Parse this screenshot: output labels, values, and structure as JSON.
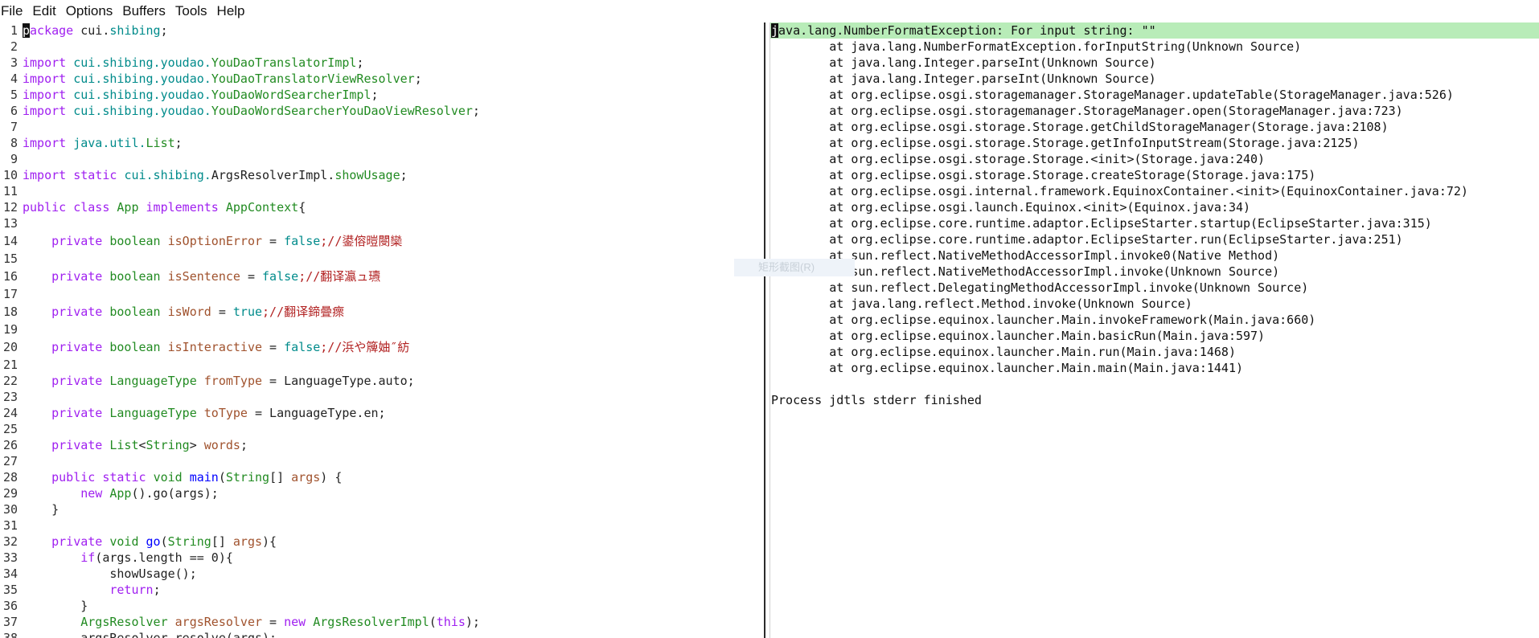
{
  "menu": [
    "File",
    "Edit",
    "Options",
    "Buffers",
    "Tools",
    "Help"
  ],
  "editor": {
    "lines": [
      {
        "n": "1",
        "parts": [
          {
            "t": "p",
            "c": "cursor"
          },
          {
            "t": "ackage ",
            "c": "kw"
          },
          {
            "t": "cui.",
            "c": ""
          },
          {
            "t": "shibing",
            "c": "pk"
          },
          {
            "t": ";",
            "c": ""
          }
        ]
      },
      {
        "n": "2",
        "parts": []
      },
      {
        "n": "3",
        "parts": [
          {
            "t": "import ",
            "c": "kw"
          },
          {
            "t": "cui.",
            "c": "pk"
          },
          {
            "t": "shibing.youdao.",
            "c": "pk"
          },
          {
            "t": "YouDaoTranslatorImpl",
            "c": "ty"
          },
          {
            "t": ";",
            "c": ""
          }
        ]
      },
      {
        "n": "4",
        "parts": [
          {
            "t": "import ",
            "c": "kw"
          },
          {
            "t": "cui.",
            "c": "pk"
          },
          {
            "t": "shibing.youdao.",
            "c": "pk"
          },
          {
            "t": "YouDaoTranslatorViewResolver",
            "c": "ty"
          },
          {
            "t": ";",
            "c": ""
          }
        ]
      },
      {
        "n": "5",
        "parts": [
          {
            "t": "import ",
            "c": "kw"
          },
          {
            "t": "cui.",
            "c": "pk"
          },
          {
            "t": "shibing.youdao.",
            "c": "pk"
          },
          {
            "t": "YouDaoWordSearcherImpl",
            "c": "ty"
          },
          {
            "t": ";",
            "c": ""
          }
        ]
      },
      {
        "n": "6",
        "parts": [
          {
            "t": "import ",
            "c": "kw"
          },
          {
            "t": "cui.",
            "c": "pk"
          },
          {
            "t": "shibing.youdao.",
            "c": "pk"
          },
          {
            "t": "YouDaoWordSearcherYouDaoViewResolver",
            "c": "ty"
          },
          {
            "t": ";",
            "c": ""
          }
        ]
      },
      {
        "n": "7",
        "parts": []
      },
      {
        "n": "8",
        "parts": [
          {
            "t": "import ",
            "c": "kw"
          },
          {
            "t": "java.util.",
            "c": "pk"
          },
          {
            "t": "List",
            "c": "ty"
          },
          {
            "t": ";",
            "c": ""
          }
        ]
      },
      {
        "n": "9",
        "parts": []
      },
      {
        "n": "10",
        "parts": [
          {
            "t": "import static ",
            "c": "kw"
          },
          {
            "t": "cui.shibing.",
            "c": "pk"
          },
          {
            "t": "ArgsResolverImpl.",
            "c": ""
          },
          {
            "t": "showUsage",
            "c": "ty"
          },
          {
            "t": ";",
            "c": ""
          }
        ]
      },
      {
        "n": "11",
        "parts": []
      },
      {
        "n": "12",
        "parts": [
          {
            "t": "public class ",
            "c": "kw"
          },
          {
            "t": "App ",
            "c": "ty"
          },
          {
            "t": "implements ",
            "c": "kw"
          },
          {
            "t": "AppContext",
            "c": "ty"
          },
          {
            "t": "{",
            "c": ""
          }
        ]
      },
      {
        "n": "13",
        "parts": []
      },
      {
        "n": "14",
        "tall": true,
        "parts": [
          {
            "t": "    private ",
            "c": "kw"
          },
          {
            "t": "boolean ",
            "c": "ty"
          },
          {
            "t": "isOptionError",
            "c": "var"
          },
          {
            "t": " = ",
            "c": ""
          },
          {
            "t": "false",
            "c": "cst"
          },
          {
            "t": ";//鍙傛暟閿欒",
            "c": "cm"
          }
        ]
      },
      {
        "n": "15",
        "parts": []
      },
      {
        "n": "16",
        "tall": true,
        "parts": [
          {
            "t": "    private ",
            "c": "kw"
          },
          {
            "t": "boolean ",
            "c": "ty"
          },
          {
            "t": "isSentence",
            "c": "var"
          },
          {
            "t": " = ",
            "c": ""
          },
          {
            "t": "false",
            "c": "cst"
          },
          {
            "t": ";//翻译瀛ュ瓙",
            "c": "cm"
          }
        ]
      },
      {
        "n": "17",
        "parts": []
      },
      {
        "n": "18",
        "tall": true,
        "parts": [
          {
            "t": "    private ",
            "c": "kw"
          },
          {
            "t": "boolean ",
            "c": "ty"
          },
          {
            "t": "isWord",
            "c": "var"
          },
          {
            "t": " = ",
            "c": ""
          },
          {
            "t": "true",
            "c": "cst"
          },
          {
            "t": ";//翻译鍗曡瘝",
            "c": "cm"
          }
        ]
      },
      {
        "n": "19",
        "parts": []
      },
      {
        "n": "20",
        "tall": true,
        "parts": [
          {
            "t": "    private ",
            "c": "kw"
          },
          {
            "t": "boolean ",
            "c": "ty"
          },
          {
            "t": "isInteractive",
            "c": "var"
          },
          {
            "t": " = ",
            "c": ""
          },
          {
            "t": "false",
            "c": "cst"
          },
          {
            "t": ";//浜や簰妯″紡",
            "c": "cm"
          }
        ]
      },
      {
        "n": "21",
        "parts": []
      },
      {
        "n": "22",
        "parts": [
          {
            "t": "    private ",
            "c": "kw"
          },
          {
            "t": "LanguageType ",
            "c": "ty"
          },
          {
            "t": "fromType",
            "c": "var"
          },
          {
            "t": " = LanguageType.auto;",
            "c": ""
          }
        ]
      },
      {
        "n": "23",
        "parts": []
      },
      {
        "n": "24",
        "parts": [
          {
            "t": "    private ",
            "c": "kw"
          },
          {
            "t": "LanguageType ",
            "c": "ty"
          },
          {
            "t": "toType",
            "c": "var"
          },
          {
            "t": " = LanguageType.en;",
            "c": ""
          }
        ]
      },
      {
        "n": "25",
        "parts": []
      },
      {
        "n": "26",
        "parts": [
          {
            "t": "    private ",
            "c": "kw"
          },
          {
            "t": "List",
            "c": "ty"
          },
          {
            "t": "<",
            "c": ""
          },
          {
            "t": "String",
            "c": "ty"
          },
          {
            "t": "> ",
            "c": ""
          },
          {
            "t": "words",
            "c": "var"
          },
          {
            "t": ";",
            "c": ""
          }
        ]
      },
      {
        "n": "27",
        "parts": []
      },
      {
        "n": "28",
        "parts": [
          {
            "t": "    public static ",
            "c": "kw"
          },
          {
            "t": "void ",
            "c": "ty"
          },
          {
            "t": "main",
            "c": "fn"
          },
          {
            "t": "(",
            "c": ""
          },
          {
            "t": "String",
            "c": "ty"
          },
          {
            "t": "[] ",
            "c": ""
          },
          {
            "t": "args",
            "c": "var"
          },
          {
            "t": ") {",
            "c": ""
          }
        ]
      },
      {
        "n": "29",
        "parts": [
          {
            "t": "        new ",
            "c": "kw"
          },
          {
            "t": "App",
            "c": "ty"
          },
          {
            "t": "().go(args);",
            "c": ""
          }
        ]
      },
      {
        "n": "30",
        "parts": [
          {
            "t": "    }",
            "c": ""
          }
        ]
      },
      {
        "n": "31",
        "parts": []
      },
      {
        "n": "32",
        "parts": [
          {
            "t": "    private ",
            "c": "kw"
          },
          {
            "t": "void ",
            "c": "ty"
          },
          {
            "t": "go",
            "c": "fn"
          },
          {
            "t": "(",
            "c": ""
          },
          {
            "t": "String",
            "c": "ty"
          },
          {
            "t": "[] ",
            "c": ""
          },
          {
            "t": "args",
            "c": "var"
          },
          {
            "t": "){",
            "c": ""
          }
        ]
      },
      {
        "n": "33",
        "parts": [
          {
            "t": "        if",
            "c": "kw"
          },
          {
            "t": "(args.length == 0){",
            "c": ""
          }
        ]
      },
      {
        "n": "34",
        "parts": [
          {
            "t": "            showUsage();",
            "c": ""
          }
        ]
      },
      {
        "n": "35",
        "parts": [
          {
            "t": "            return",
            "c": "kw"
          },
          {
            "t": ";",
            "c": ""
          }
        ]
      },
      {
        "n": "36",
        "parts": [
          {
            "t": "        }",
            "c": ""
          }
        ]
      },
      {
        "n": "37",
        "parts": [
          {
            "t": "        ArgsResolver ",
            "c": "ty"
          },
          {
            "t": "argsResolver",
            "c": "var"
          },
          {
            "t": " = ",
            "c": ""
          },
          {
            "t": "new ",
            "c": "kw"
          },
          {
            "t": "ArgsResolverImpl",
            "c": "ty"
          },
          {
            "t": "(",
            "c": ""
          },
          {
            "t": "this",
            "c": "kw"
          },
          {
            "t": ");",
            "c": ""
          }
        ]
      },
      {
        "n": "38",
        "parts": [
          {
            "t": "        argsResolver.resolve(args);",
            "c": ""
          }
        ]
      }
    ]
  },
  "output": {
    "lines": [
      "java.lang.NumberFormatException: For input string: \"\"",
      "        at java.lang.NumberFormatException.forInputString(Unknown Source)",
      "        at java.lang.Integer.parseInt(Unknown Source)",
      "        at java.lang.Integer.parseInt(Unknown Source)",
      "        at org.eclipse.osgi.storagemanager.StorageManager.updateTable(StorageManager.java:526)",
      "        at org.eclipse.osgi.storagemanager.StorageManager.open(StorageManager.java:723)",
      "        at org.eclipse.osgi.storage.Storage.getChildStorageManager(Storage.java:2108)",
      "        at org.eclipse.osgi.storage.Storage.getInfoInputStream(Storage.java:2125)",
      "        at org.eclipse.osgi.storage.Storage.<init>(Storage.java:240)",
      "        at org.eclipse.osgi.storage.Storage.createStorage(Storage.java:175)",
      "        at org.eclipse.osgi.internal.framework.EquinoxContainer.<init>(EquinoxContainer.java:72)",
      "        at org.eclipse.osgi.launch.Equinox.<init>(Equinox.java:34)",
      "        at org.eclipse.core.runtime.adaptor.EclipseStarter.startup(EclipseStarter.java:315)",
      "        at org.eclipse.core.runtime.adaptor.EclipseStarter.run(EclipseStarter.java:251)",
      "        at sun.reflect.NativeMethodAccessorImpl.invoke0(Native Method)",
      "        at sun.reflect.NativeMethodAccessorImpl.invoke(Unknown Source)",
      "        at sun.reflect.DelegatingMethodAccessorImpl.invoke(Unknown Source)",
      "        at java.lang.reflect.Method.invoke(Unknown Source)",
      "        at org.eclipse.equinox.launcher.Main.invokeFramework(Main.java:660)",
      "        at org.eclipse.equinox.launcher.Main.basicRun(Main.java:597)",
      "        at org.eclipse.equinox.launcher.Main.run(Main.java:1468)",
      "        at org.eclipse.equinox.launcher.Main.main(Main.java:1441)",
      "",
      "Process jdtls stderr finished"
    ]
  },
  "watermark": "矩形截图(R)"
}
